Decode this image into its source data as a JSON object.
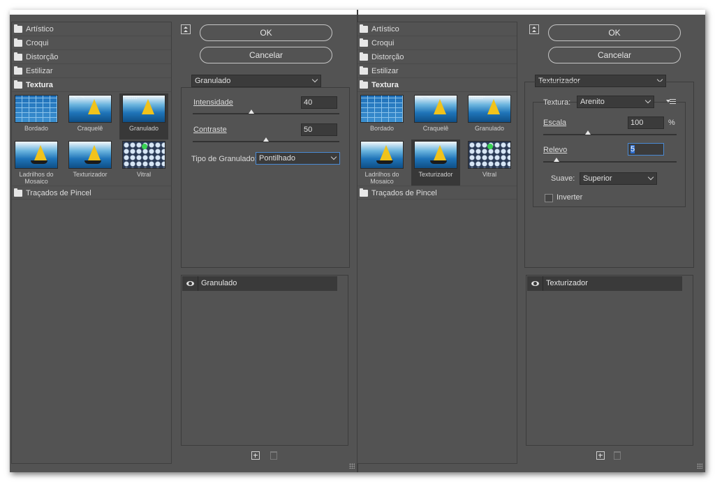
{
  "categories": [
    {
      "label": "Artístico"
    },
    {
      "label": "Croqui"
    },
    {
      "label": "Distorção"
    },
    {
      "label": "Estilizar"
    },
    {
      "label": "Textura"
    },
    {
      "label": "Traçados de Pincel"
    }
  ],
  "texture_filters": [
    {
      "label": "Bordado",
      "icon": "tiles-thumbnail"
    },
    {
      "label": "Craquelê",
      "icon": "sailboat-crack-thumbnail"
    },
    {
      "label": "Granulado",
      "icon": "sailboat-grain-thumbnail"
    },
    {
      "label": "Ladrilhos do Mosaico",
      "icon": "sailboat-mosaic-thumbnail"
    },
    {
      "label": "Texturizador",
      "icon": "sailboat-texture-thumbnail"
    },
    {
      "label": "Vitral",
      "icon": "stained-glass-thumbnail"
    }
  ],
  "buttons": {
    "ok": "OK",
    "cancel": "Cancelar"
  },
  "left_panel": {
    "filter_select": "Granulado",
    "selected_thumbnail": "Granulado",
    "intensity_label": "Intensidade",
    "intensity_value": "40",
    "intensity_level_pct": 40,
    "contrast_label": "Contraste",
    "contrast_value": "50",
    "contrast_level_pct": 50,
    "grain_type_label": "Tipo de Granulado:",
    "grain_type_value": "Pontilhado",
    "layer_name": "Granulado"
  },
  "right_panel": {
    "filter_select": "Texturizador",
    "selected_thumbnail": "Texturizador",
    "texture_label": "Textura:",
    "texture_value": "Arenito",
    "scale_label": "Escala",
    "scale_value": "100",
    "scale_unit": "%",
    "scale_level_pct": 33,
    "relief_label": "Relevo",
    "relief_value": "5",
    "relief_level_pct": 10,
    "light_label": "Suave:",
    "light_value": "Superior",
    "invert_label": "Inverter",
    "invert_checked": false,
    "layer_name": "Texturizador"
  },
  "colors": {
    "panel": "#535353",
    "dark_field": "#3b3b3b",
    "focus": "#4a8ad4"
  }
}
